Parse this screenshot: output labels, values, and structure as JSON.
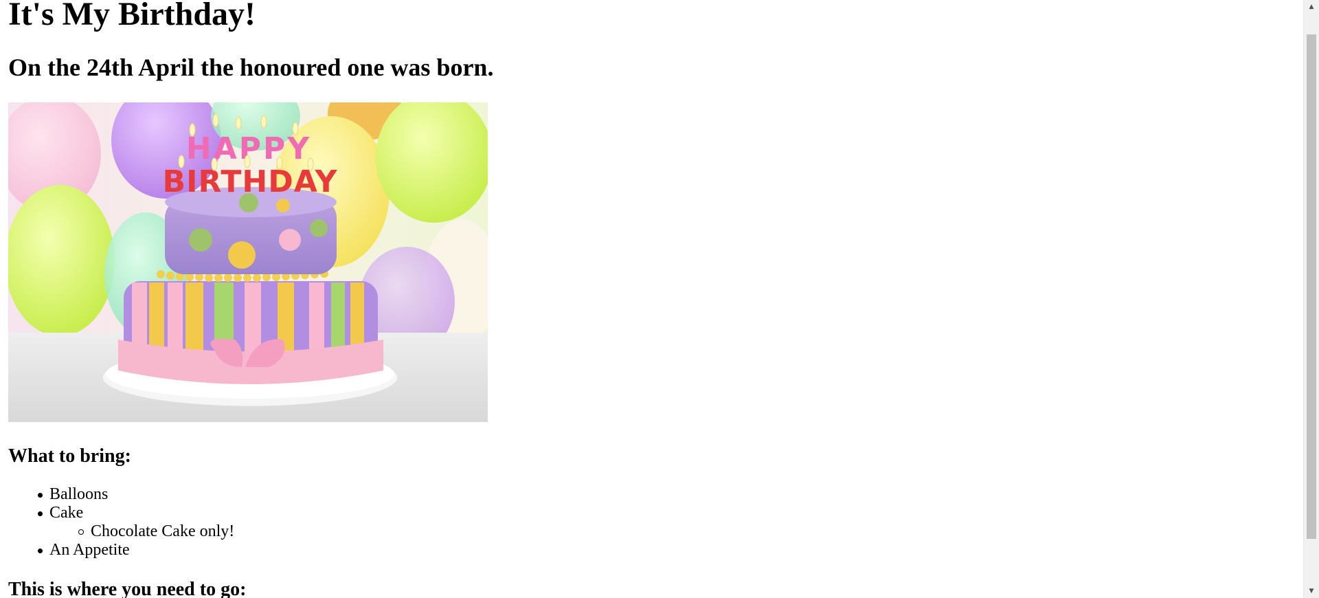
{
  "page": {
    "title": "It's My Birthday!",
    "subtitle": "On the 24th April the honoured one was born."
  },
  "hero_image": {
    "cake_text_line1": "HAPPY",
    "cake_text_line2": "BIRTHDAY"
  },
  "bring": {
    "heading": "What to bring:",
    "items": [
      "Balloons",
      "Cake",
      "An Appetite"
    ],
    "cake_subitems": [
      "Chocolate Cake only!"
    ]
  },
  "location": {
    "heading": "This is where you need to go:"
  },
  "scrollbar": {
    "up_icon": "scroll-up-arrow",
    "down_icon": "scroll-down-arrow"
  },
  "colors": {
    "thumb": "#c1c1c1",
    "track": "#f1f1f1"
  }
}
